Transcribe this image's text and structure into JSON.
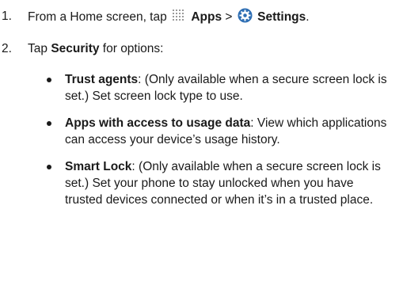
{
  "steps": [
    {
      "number": "1.",
      "prefix": "From a Home screen, tap",
      "apps_label": "Apps",
      "separator": ">",
      "settings_label": "Settings",
      "suffix": ".",
      "apps_icon": "apps-grid-icon",
      "settings_icon": "settings-gear-icon"
    },
    {
      "number": "2.",
      "prefix": "Tap",
      "security_label": "Security",
      "suffix": "for options:"
    }
  ],
  "options": [
    {
      "title": "Trust agents",
      "description": ": (Only available when a secure screen lock is set.) Set screen lock type to use."
    },
    {
      "title": "Apps with access to usage data",
      "description": ": View which applications can access your device’s usage history."
    },
    {
      "title": "Smart Lock",
      "description": ": (Only available when a secure screen lock is set.) Set your phone to stay unlocked when you have trusted devices connected or when it’s in a trusted place."
    }
  ],
  "colors": {
    "text": "#1a1a1a",
    "settings_icon_blue": "#3b82c4"
  }
}
